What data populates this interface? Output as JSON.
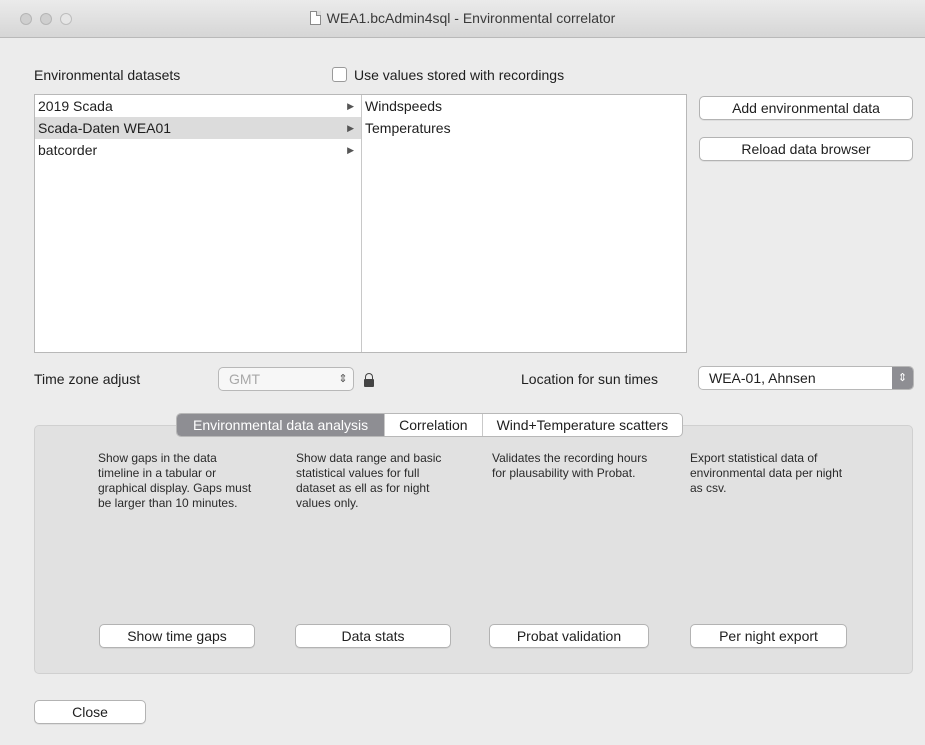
{
  "window": {
    "title": "WEA1.bcAdmin4sql - Environmental correlator"
  },
  "datasets_label": "Environmental datasets",
  "use_stored_label": "Use values stored with recordings",
  "datasets": [
    "2019 Scada",
    "Scada-Daten WEA01",
    "batcorder"
  ],
  "selected_dataset_index": 1,
  "subitems": [
    "Windspeeds",
    "Temperatures"
  ],
  "buttons": {
    "add_env": "Add environmental data",
    "reload": "Reload data browser",
    "close": "Close"
  },
  "timezone": {
    "label": "Time zone adjust",
    "value": "GMT"
  },
  "location": {
    "label": "Location for sun times",
    "value": "WEA-01, Ahnsen"
  },
  "tabs": [
    "Environmental data analysis",
    "Correlation",
    "Wind+Temperature scatters"
  ],
  "active_tab_index": 0,
  "analysis": [
    {
      "description": "Show gaps in the data timeline in a tabular or graphical display. Gaps must be larger than 10 minutes.",
      "button": "Show time gaps"
    },
    {
      "description": "Show data range and basic statistical values for full dataset as ell as for night values only.",
      "button": "Data stats"
    },
    {
      "description": "Validates the recording hours for plausability with Probat.",
      "button": "Probat validation"
    },
    {
      "description": "Export statistical data of environmental data per night as csv.",
      "button": "Per night export"
    }
  ],
  "colors": {
    "active_tab": "#8e8e93",
    "window_bg": "#ececec",
    "selection": "#dcdcdc"
  }
}
